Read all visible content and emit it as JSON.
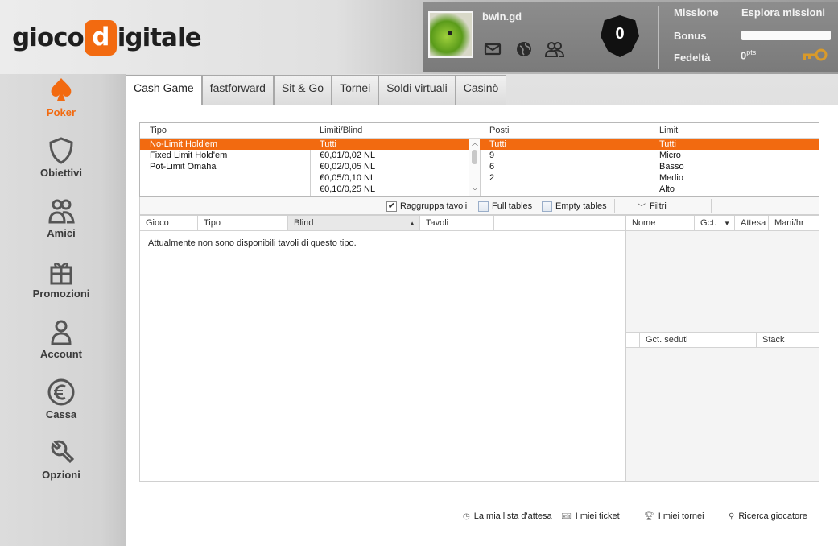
{
  "header": {
    "logo_left": "gioco",
    "logo_letter": "d",
    "logo_right": "igitale",
    "username": "bwin.gd",
    "shield_count": "0",
    "mission_label": "Missione",
    "explore_missions": "Esplora missioni",
    "bonus_label": "Bonus",
    "fidelity_label": "Fedeltà",
    "points_value": "0",
    "points_unit": "pts"
  },
  "sidebar": {
    "items": [
      {
        "label": "Poker",
        "icon": "spade-icon",
        "active": true
      },
      {
        "label": "Obiettivi",
        "icon": "shield-icon"
      },
      {
        "label": "Amici",
        "icon": "friends-icon"
      },
      {
        "label": "Promozioni",
        "icon": "gift-icon"
      },
      {
        "label": "Account",
        "icon": "user-icon"
      },
      {
        "label": "Cassa",
        "icon": "euro-icon"
      },
      {
        "label": "Opzioni",
        "icon": "wrench-icon"
      }
    ]
  },
  "tabs": [
    {
      "label": "Cash Game",
      "active": true
    },
    {
      "label": "fastforward"
    },
    {
      "label": "Sit & Go"
    },
    {
      "label": "Tornei"
    },
    {
      "label": "Soldi virtuali"
    },
    {
      "label": "Casinò"
    }
  ],
  "filters": {
    "tipo": {
      "header": "Tipo",
      "items": [
        "No-Limit Hold'em",
        "Fixed Limit Hold'em",
        "Pot-Limit Omaha"
      ],
      "selected": 0
    },
    "blind": {
      "header": "Limiti/Blind",
      "items": [
        "Tutti",
        "€0,01/0,02 NL",
        "€0,02/0,05 NL",
        "€0,05/0,10 NL",
        "€0,10/0,25 NL"
      ],
      "selected": 0
    },
    "posti": {
      "header": "Posti",
      "items": [
        "Tutti",
        "9",
        "6",
        "2"
      ],
      "selected": 0
    },
    "limiti": {
      "header": "Limiti",
      "items": [
        "Tutti",
        "Micro",
        "Basso",
        "Medio",
        "Alto"
      ],
      "selected": 0
    }
  },
  "options": {
    "group_tables": "Raggruppa tavoli",
    "group_tables_checked": true,
    "full_tables": "Full tables",
    "empty_tables": "Empty tables",
    "filters": "Filtri"
  },
  "grid": {
    "columns": [
      "Gioco",
      "Tipo",
      "Blind",
      "Tavoli"
    ],
    "empty_message": "Attualmente non sono disponibili tavoli di questo tipo."
  },
  "players_grid": {
    "columns": [
      "Nome",
      "Gct.",
      "Attesa",
      "Mani/hr"
    ]
  },
  "seats_grid": {
    "columns": [
      "Gct. seduti",
      "Stack"
    ]
  },
  "footer": {
    "waitlist": "La mia lista d'attesa",
    "tickets": "I miei ticket",
    "tournaments": "I miei tornei",
    "player_search": "Ricerca giocatore"
  }
}
